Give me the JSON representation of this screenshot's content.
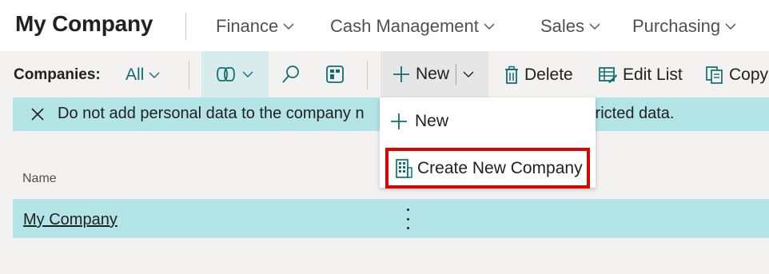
{
  "header": {
    "company_title": "My Company",
    "nav": [
      "Finance",
      "Cash Management",
      "Sales",
      "Purchasing"
    ]
  },
  "actionbar": {
    "companies_label": "Companies:",
    "filter_value": "All",
    "new_label": "New",
    "delete_label": "Delete",
    "edit_list_label": "Edit List",
    "copy_label": "Copy"
  },
  "notification": {
    "text": "Do not add personal data to the company n                                              restricted data."
  },
  "list": {
    "column_name": "Name",
    "rows": [
      {
        "name": "My Company"
      }
    ]
  },
  "menu": {
    "items": [
      "New",
      "Create New Company"
    ]
  },
  "colors": {
    "accent": "#0f6e74",
    "highlight": "#b3e5e7",
    "callout": "#e00000"
  }
}
